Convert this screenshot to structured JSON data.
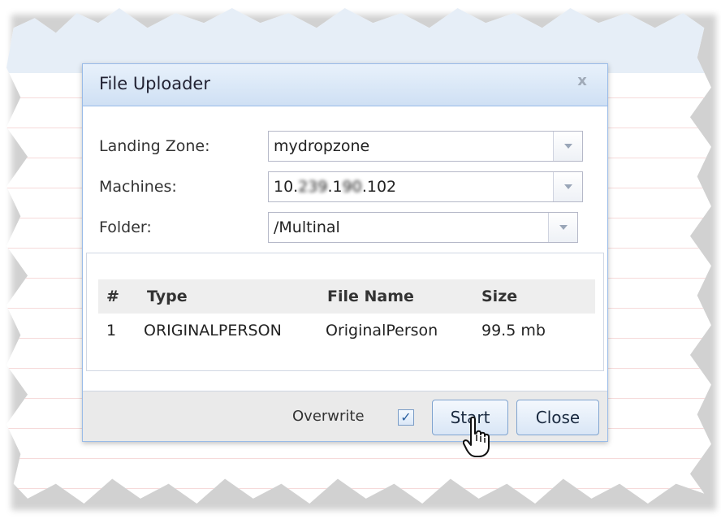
{
  "dialog": {
    "title": "File Uploader",
    "close_glyph": "x"
  },
  "form": {
    "landing_zone": {
      "label": "Landing Zone:",
      "value": "mydropzone"
    },
    "machines": {
      "label": "Machines:",
      "value_prefix": "10.",
      "value_masked_1": "239",
      "value_mid": ".1",
      "value_masked_2": "90",
      "value_suffix": ".102"
    },
    "folder": {
      "label": "Folder:",
      "value": "/Multinal"
    }
  },
  "grid": {
    "headers": [
      "#",
      "Type",
      "File Name",
      "Size"
    ],
    "rows": [
      {
        "num": "1",
        "type": "ORIGINALPERSON",
        "file_name": "OriginalPerson",
        "size": "99.5 mb"
      }
    ]
  },
  "footer": {
    "overwrite_label": "Overwrite",
    "overwrite_checked": true,
    "checkmark": "✓",
    "start_label": "Start",
    "close_label": "Close"
  },
  "colors": {
    "title_gradient_top": "#e8f1fb",
    "title_gradient_bottom": "#cfe0f4",
    "border": "#99bbe8"
  },
  "icons": [
    "close-icon",
    "chevron-down-icon",
    "checkbox-checked-icon",
    "hand-pointer-cursor-icon"
  ]
}
